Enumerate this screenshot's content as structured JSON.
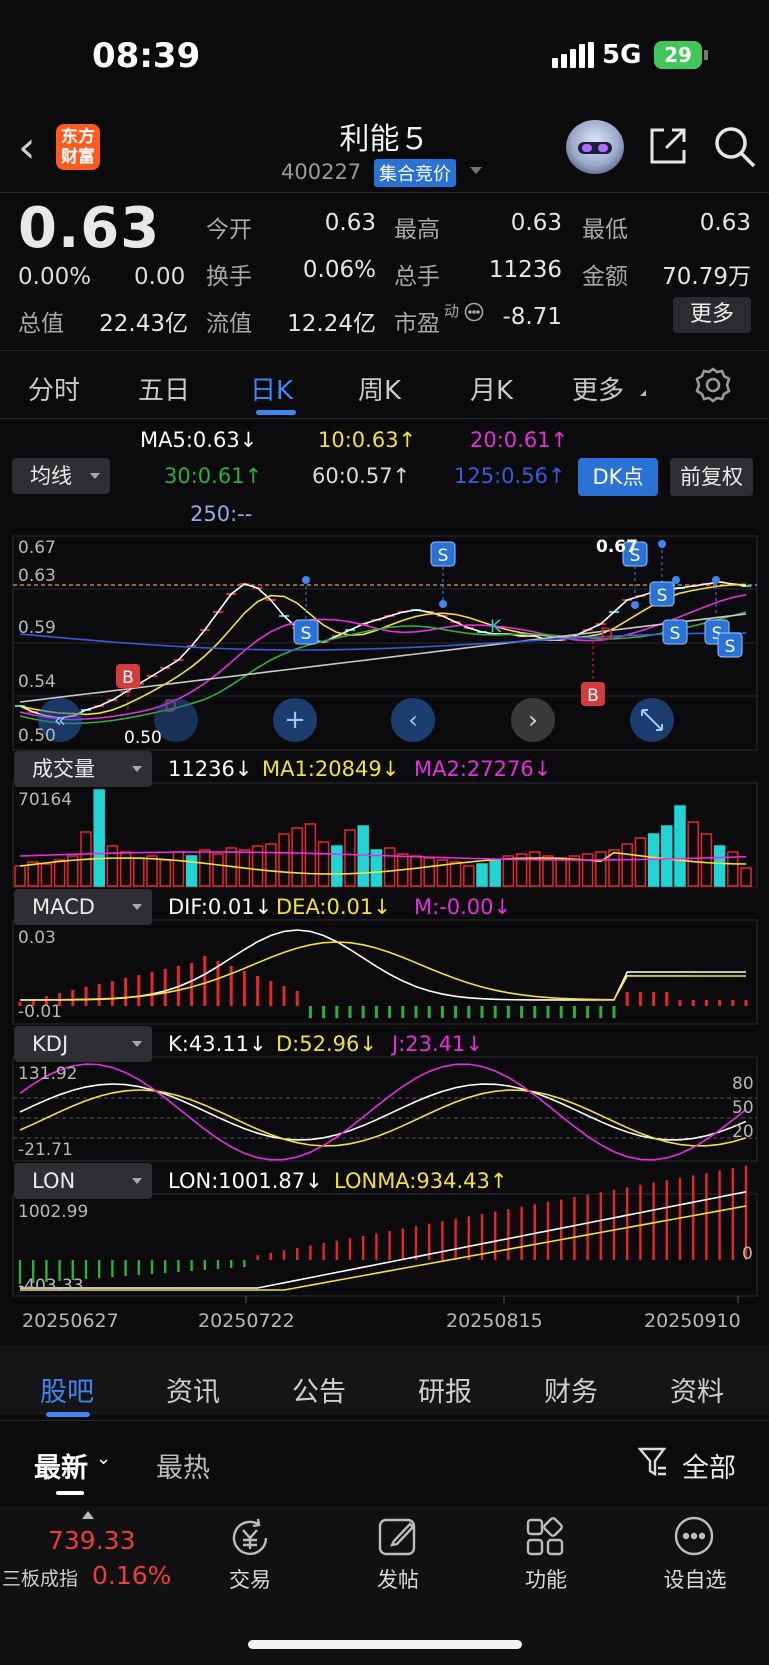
{
  "status": {
    "time": "08:39",
    "network": "5G",
    "battery": "29"
  },
  "header": {
    "title": "利能５",
    "code": "400227",
    "tag": "集合竞价",
    "logo_line1": "东方",
    "logo_line2": "财富"
  },
  "quote": {
    "price": "0.63",
    "change_pct": "0.00%",
    "change": "0.00",
    "rows": [
      [
        {
          "label": "今开",
          "value": "0.63"
        },
        {
          "label": "最高",
          "value": "0.63"
        },
        {
          "label": "最低",
          "value": "0.63"
        }
      ],
      [
        {
          "label": "换手",
          "value": "0.06%"
        },
        {
          "label": "总手",
          "value": "11236"
        },
        {
          "label": "金额",
          "value": "70.79万"
        }
      ]
    ],
    "total_cap_label": "总值",
    "total_cap": "22.43亿",
    "float_cap_label": "流值",
    "float_cap": "12.24亿",
    "pe_label": "市盈",
    "pe_sup": "动",
    "pe": "-8.71",
    "more": "更多"
  },
  "tabs": [
    "分时",
    "五日",
    "日K",
    "周K",
    "月K",
    "更多"
  ],
  "active_tab": "日K",
  "ma": {
    "ma5": "MA5:0.63↓",
    "ma10": "10:0.63↑",
    "ma20": "20:0.61↑",
    "ma30": "30:0.61↑",
    "ma60": "60:0.57↑",
    "ma125": "125:0.56↑",
    "ma250": "250:--",
    "selector": "均线",
    "dk": "DK点",
    "fq": "前复权"
  },
  "colors": {
    "up": "#e8262a",
    "down": "#22d3d3",
    "ma5": "#ffffff",
    "ma10": "#f2e234",
    "ma20": "#e62ee0",
    "ma30": "#2fae3c",
    "ma60": "#c8c8c8",
    "ma125": "#3a5bd9",
    "ma250": "#9aa9e6",
    "accent": "#3e86f0"
  },
  "kline": {
    "y_top": "0.67",
    "y_mid1": "0.63",
    "y_mid2": "0.59",
    "y_mid3": "0.54",
    "y_bot": "0.50",
    "max_label": "0.67",
    "min_label": "0.50"
  },
  "volume": {
    "selector": "成交量",
    "v": "11236↓",
    "ma1": "MA1:20849↓",
    "ma2": "MA2:27276↓",
    "y_top": "70164"
  },
  "macd": {
    "selector": "MACD",
    "dif": "DIF:0.01↓",
    "dea": "DEA:0.01↓",
    "m": "M:-0.00↓",
    "y_top": "0.03",
    "y_bot": "-0.01"
  },
  "kdj": {
    "selector": "KDJ",
    "k": "K:43.11↓",
    "d": "D:52.96↓",
    "j": "J:23.41↓",
    "y_top": "131.92",
    "y_bot": "-21.71",
    "r80": "80",
    "r50": "50",
    "r20": "20"
  },
  "lon": {
    "selector": "LON",
    "lon": "LON:1001.87↓",
    "lonma": "LONMA:934.43↑",
    "y_top": "1002.99",
    "y_bot": "-403.33",
    "r0": "0"
  },
  "dates": [
    "20250627",
    "20250722",
    "20250815",
    "20250910"
  ],
  "bottom_tabs": [
    "股吧",
    "资讯",
    "公告",
    "研报",
    "财务",
    "资料"
  ],
  "sub_tabs": {
    "latest": "最新",
    "hot": "最热",
    "all": "全部"
  },
  "index": {
    "value": "739.33",
    "name": "三板成指",
    "pct": "0.16%"
  },
  "bottom_nav": [
    "交易",
    "发帖",
    "功能",
    "设自选"
  ]
}
